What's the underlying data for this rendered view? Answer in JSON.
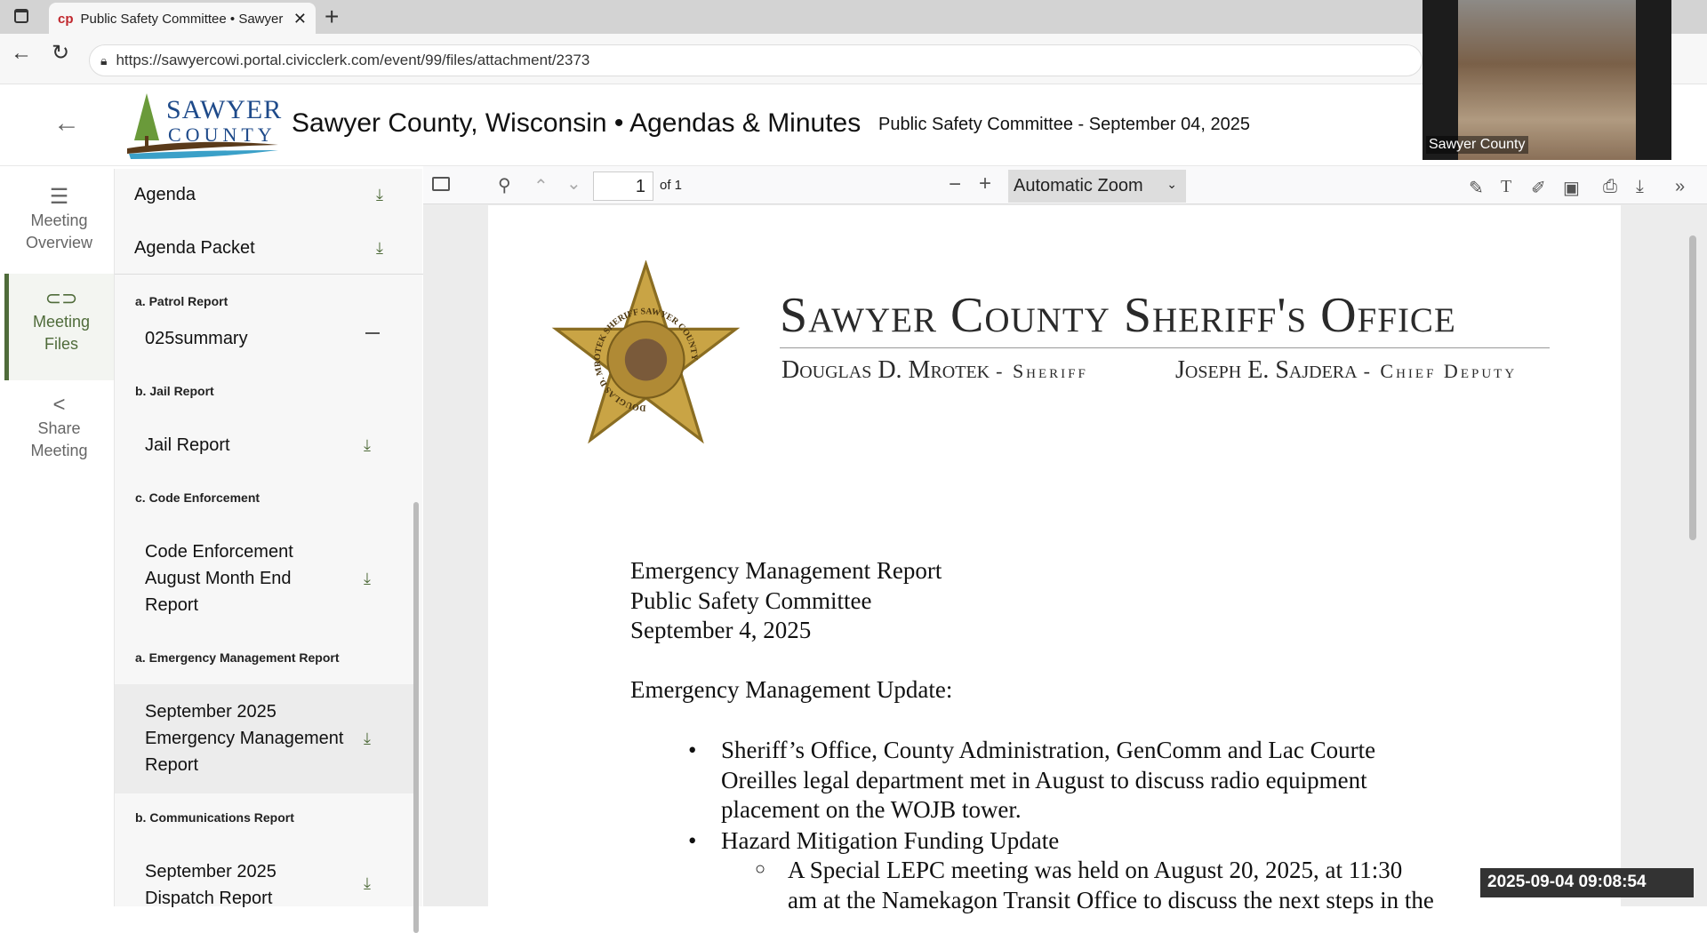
{
  "browser": {
    "tab_title": "Public Safety Committee • Sawyer",
    "url": "https://sawyercowi.portal.civicclerk.com/event/99/files/attachment/2373"
  },
  "header": {
    "logo_line1": "SAWYER",
    "logo_line2": "COUNTY",
    "title": "Sawyer County, Wisconsin • Agendas & Minutes",
    "meeting": "Public Safety Committee - September 04, 2025"
  },
  "nav": [
    {
      "l1": "Meeting",
      "l2": "Overview"
    },
    {
      "l1": "Meeting",
      "l2": "Files"
    },
    {
      "l1": "Share",
      "l2": "Meeting"
    }
  ],
  "files": {
    "top": [
      "Agenda",
      "Agenda Packet"
    ],
    "sections": [
      {
        "header": "a. Patrol Report",
        "item": "025summary"
      },
      {
        "header": "b. Jail Report",
        "item": "Jail Report"
      },
      {
        "header": "c. Code Enforcement",
        "item": [
          "Code Enforcement",
          "August Month End",
          "Report"
        ]
      },
      {
        "header": "a. Emergency Management Report",
        "item": [
          "September 2025",
          "Emergency Management",
          "Report"
        ]
      },
      {
        "header": "b. Communications Report",
        "item": [
          "September 2025",
          "Dispatch Report"
        ]
      }
    ]
  },
  "viewer": {
    "page": "1",
    "of": "of 1",
    "zoom": "Automatic Zoom"
  },
  "document": {
    "org": "Sawyer County Sheriff's Office",
    "sheriff": "Douglas D. Mrotek",
    "sheriff_title": "- Sheriff",
    "deputy": "Joseph E. Sajdera",
    "deputy_title": "- Chief Deputy",
    "badge_text": "DOUGLAS D. MROTEK SHERIFF SAWYER COUNTY",
    "lines": [
      "Emergency Management Report",
      "Public Safety Committee",
      "September 4, 2025",
      "Emergency Management Update:"
    ],
    "bullet1": [
      "Sheriff’s Office, County Administration, GenComm and Lac Courte",
      "Oreilles legal department met in August to discuss radio equipment",
      "placement on the WOJB tower."
    ],
    "bullet2": "Hazard Mitigation Funding Update",
    "sub1": [
      "A Special LEPC meeting was held on August 20, 2025, at 11:30",
      "am at the Namekagon Transit Office to discuss the next steps in the"
    ]
  },
  "video": {
    "label": "Sawyer County"
  },
  "timestamp": "2025-09-04 09:08:54",
  "colors": {
    "accent": "#4f6b3a"
  }
}
